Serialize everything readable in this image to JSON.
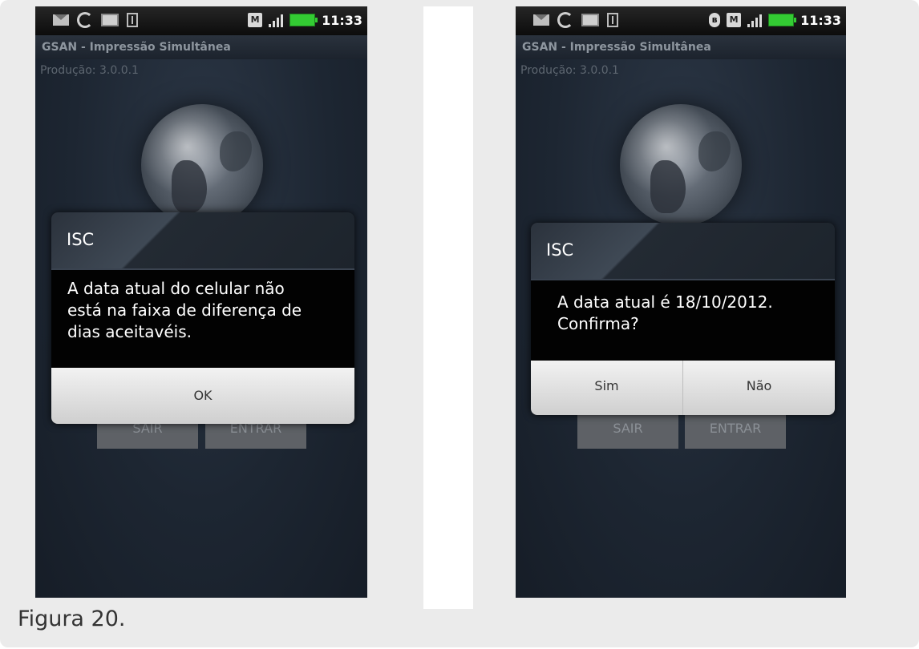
{
  "caption": "Figura 20.",
  "screens": [
    {
      "status_bar": {
        "time": "11:33",
        "icons": [
          "mail-icon",
          "sync-icon",
          "sd-card-icon",
          "usb-icon",
          "m-icon",
          "signal-icon",
          "battery-icon"
        ]
      },
      "app_title": "GSAN - Impressão Simultânea",
      "version": "Produção: 3.0.0.1",
      "background_buttons": {
        "exit": "SAIR",
        "enter": "ENTRAR"
      },
      "dialog": {
        "title": "ISC",
        "message": "A data atual do celular não\nestá na faixa de diferença de\ndias aceitavéis.",
        "buttons": [
          "OK"
        ]
      }
    },
    {
      "status_bar": {
        "time": "11:33",
        "icons": [
          "mail-icon",
          "sync-icon",
          "sd-card-icon",
          "usb-icon",
          "bluetooth-icon",
          "m-icon",
          "signal-icon",
          "battery-icon"
        ]
      },
      "app_title": "GSAN - Impressão Simultânea",
      "version": "Produção: 3.0.0.1",
      "background_buttons": {
        "exit": "SAIR",
        "enter": "ENTRAR"
      },
      "dialog": {
        "title": "ISC",
        "message": "A data atual é 18/10/2012.\nConfirma?",
        "buttons": [
          "Sim",
          "Não"
        ]
      }
    }
  ]
}
